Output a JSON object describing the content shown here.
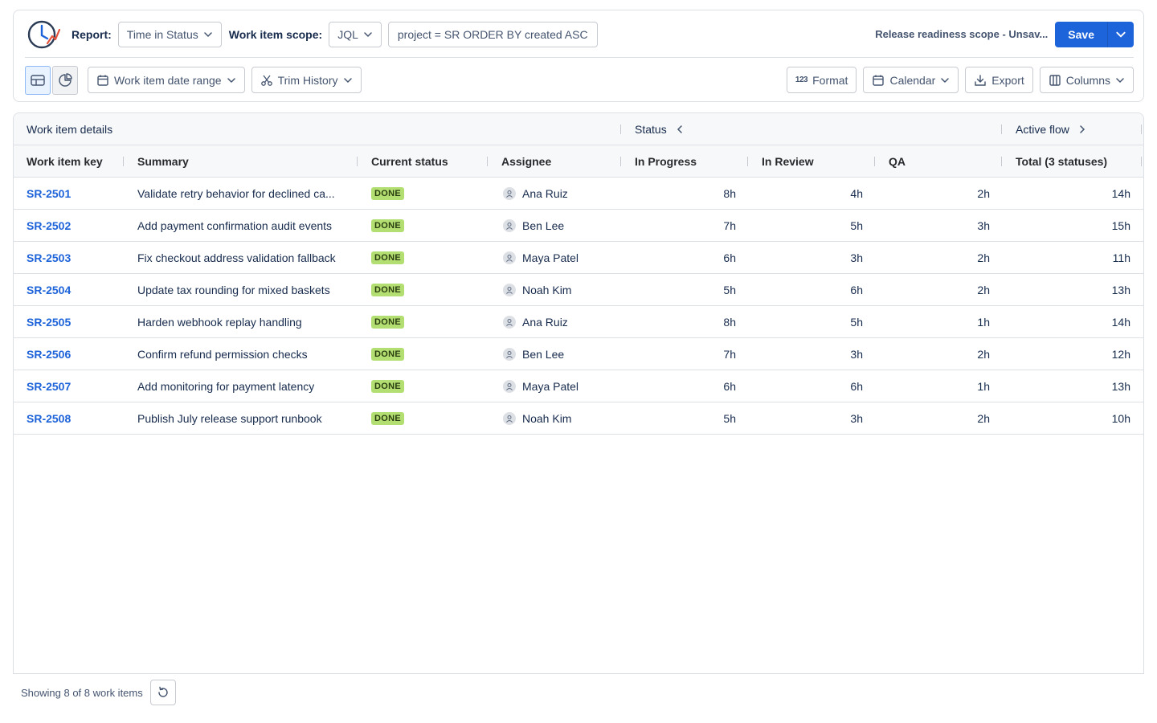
{
  "header": {
    "report_label": "Report:",
    "report_value": "Time in Status",
    "scope_label": "Work item scope:",
    "scope_mode": "JQL",
    "jql_query": "project = SR ORDER BY created ASC",
    "scope_name": "Release readiness scope - Unsav...",
    "save_label": "Save"
  },
  "toolbar": {
    "date_range": "Work item date range",
    "trim_history": "Trim History",
    "format": "Format",
    "calendar": "Calendar",
    "export": "Export",
    "columns": "Columns"
  },
  "table": {
    "groups": {
      "details": "Work item details",
      "status": "Status",
      "active_flow": "Active flow"
    },
    "columns": {
      "key": "Work item key",
      "summary": "Summary",
      "current_status": "Current status",
      "assignee": "Assignee",
      "in_progress": "In Progress",
      "in_review": "In Review",
      "qa": "QA",
      "total": "Total (3 statuses)"
    },
    "rows": [
      {
        "key": "SR-2501",
        "summary": "Validate retry behavior for declined ca...",
        "status": "DONE",
        "assignee": "Ana Ruiz",
        "in_progress": "8h",
        "in_review": "4h",
        "qa": "2h",
        "total": "14h"
      },
      {
        "key": "SR-2502",
        "summary": "Add payment confirmation audit events",
        "status": "DONE",
        "assignee": "Ben Lee",
        "in_progress": "7h",
        "in_review": "5h",
        "qa": "3h",
        "total": "15h"
      },
      {
        "key": "SR-2503",
        "summary": "Fix checkout address validation fallback",
        "status": "DONE",
        "assignee": "Maya Patel",
        "in_progress": "6h",
        "in_review": "3h",
        "qa": "2h",
        "total": "11h"
      },
      {
        "key": "SR-2504",
        "summary": "Update tax rounding for mixed baskets",
        "status": "DONE",
        "assignee": "Noah Kim",
        "in_progress": "5h",
        "in_review": "6h",
        "qa": "2h",
        "total": "13h"
      },
      {
        "key": "SR-2505",
        "summary": "Harden webhook replay handling",
        "status": "DONE",
        "assignee": "Ana Ruiz",
        "in_progress": "8h",
        "in_review": "5h",
        "qa": "1h",
        "total": "14h"
      },
      {
        "key": "SR-2506",
        "summary": "Confirm refund permission checks",
        "status": "DONE",
        "assignee": "Ben Lee",
        "in_progress": "7h",
        "in_review": "3h",
        "qa": "2h",
        "total": "12h"
      },
      {
        "key": "SR-2507",
        "summary": "Add monitoring for payment latency",
        "status": "DONE",
        "assignee": "Maya Patel",
        "in_progress": "6h",
        "in_review": "6h",
        "qa": "1h",
        "total": "13h"
      },
      {
        "key": "SR-2508",
        "summary": "Publish July release support runbook",
        "status": "DONE",
        "assignee": "Noah Kim",
        "in_progress": "5h",
        "in_review": "3h",
        "qa": "2h",
        "total": "10h"
      }
    ]
  },
  "footer": {
    "count_text": "Showing 8 of 8 work items"
  },
  "icons": {
    "logo": "clock-chart-logo-icon",
    "table_view": "table-view-icon",
    "chart_view": "pie-chart-icon",
    "calendar": "calendar-icon",
    "scissors": "scissors-icon",
    "format": "number-format-icon",
    "export": "download-icon",
    "columns": "columns-icon",
    "refresh": "refresh-icon"
  },
  "colors": {
    "primary": "#1d63d9",
    "done_badge": "#b3df72",
    "link": "#1d63d9"
  }
}
